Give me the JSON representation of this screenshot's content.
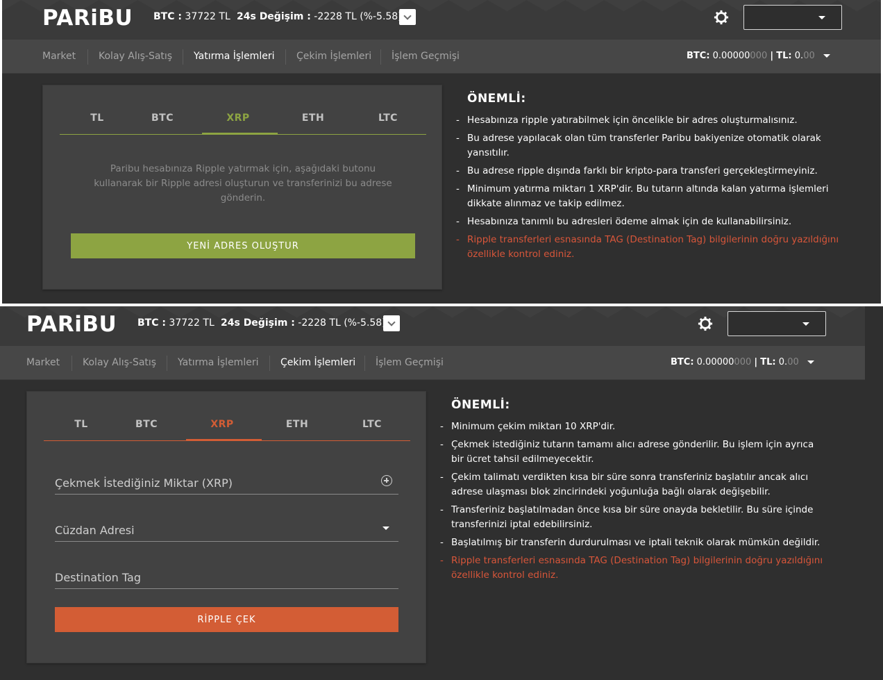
{
  "brand": {
    "logo": "PARiBU"
  },
  "ticker": {
    "btc_label": "BTC :",
    "btc_value": "37722 TL",
    "change_label": "24s Değişim :",
    "change_value": "-2228 TL (%-5.58)"
  },
  "icons": {
    "ticker_toggle": "chevron-down-icon",
    "settings": "gear-icon",
    "account_caret": "caret-down-icon"
  },
  "colors": {
    "deposit_accent": "#8da442",
    "withdraw_accent": "#d35d35",
    "warning": "#d8563a",
    "background": "#2f2f2f"
  },
  "nav": {
    "items": [
      "Market",
      "Kolay Alış-Satış",
      "Yatırma İşlemleri",
      "Çekim İşlemleri",
      "İşlem Geçmişi"
    ]
  },
  "balance": {
    "btc_label": "BTC:",
    "btc_value": "0.00000",
    "btc_value_dim": "000",
    "separator": "|",
    "tl_label": "TL:",
    "tl_value": "0.",
    "tl_value_dim": "00"
  },
  "currency_tabs": [
    "TL",
    "BTC",
    "XRP",
    "ETH",
    "LTC"
  ],
  "deposit": {
    "active_nav": "Yatırma İşlemleri",
    "active_tab": "XRP",
    "info_text": "Paribu hesabınıza Ripple yatırmak için, aşağıdaki butonu kullanarak bir Ripple adresi oluşturun ve transferinizi bu adrese gönderin.",
    "create_button": "YENİ ADRES OLUŞTUR",
    "notes_title": "ÖNEMLİ:",
    "notes": [
      "Hesabınıza ripple yatırabilmek için öncelikle bir adres oluşturmalısınız.",
      "Bu adrese yapılacak olan tüm transferler Paribu bakiyenize otomatik olarak yansıtılır.",
      "Bu adrese ripple dışında farklı bir kripto-para transferi gerçekleştirmeyiniz.",
      "Minimum yatırma miktarı 1 XRP'dir. Bu tutarın altında kalan yatırma işlemleri dikkate alınmaz ve takip edilmez.",
      "Hesabınıza tanımlı bu adresleri ödeme almak için de kullanabilirsiniz."
    ],
    "warning": "Ripple transferleri esnasında TAG (Destination Tag) bilgilerinin doğru yazıldığını özellikle kontrol ediniz."
  },
  "withdraw": {
    "active_nav": "Çekim İşlemleri",
    "active_tab": "XRP",
    "amount_label": "Çekmek İstediğiniz Miktar (XRP)",
    "wallet_label": "Cüzdan Adresi",
    "tag_label": "Destination Tag",
    "submit_button": "RİPPLE ÇEK",
    "notes_title": "ÖNEMLİ:",
    "notes": [
      "Minimum çekim miktarı 10 XRP'dir.",
      "Çekmek istediğiniz tutarın tamamı alıcı adrese gönderilir. Bu işlem için ayrıca bir ücret tahsil edilmeyecektir.",
      "Çekim talimatı verdikten kısa bir süre sonra transferiniz başlatılır ancak alıcı adrese ulaşması blok zincirindeki yoğunluğa bağlı olarak değişebilir.",
      "Transferiniz başlatılmadan önce kısa bir süre onayda bekletilir. Bu süre içinde transferinizi iptal edebilirsiniz.",
      "Başlatılmış bir transferin durdurulması ve iptali teknik olarak mümkün değildir."
    ],
    "warning": "Ripple transferleri esnasında TAG (Destination Tag) bilgilerinin doğru yazıldığını özellikle kontrol ediniz."
  }
}
